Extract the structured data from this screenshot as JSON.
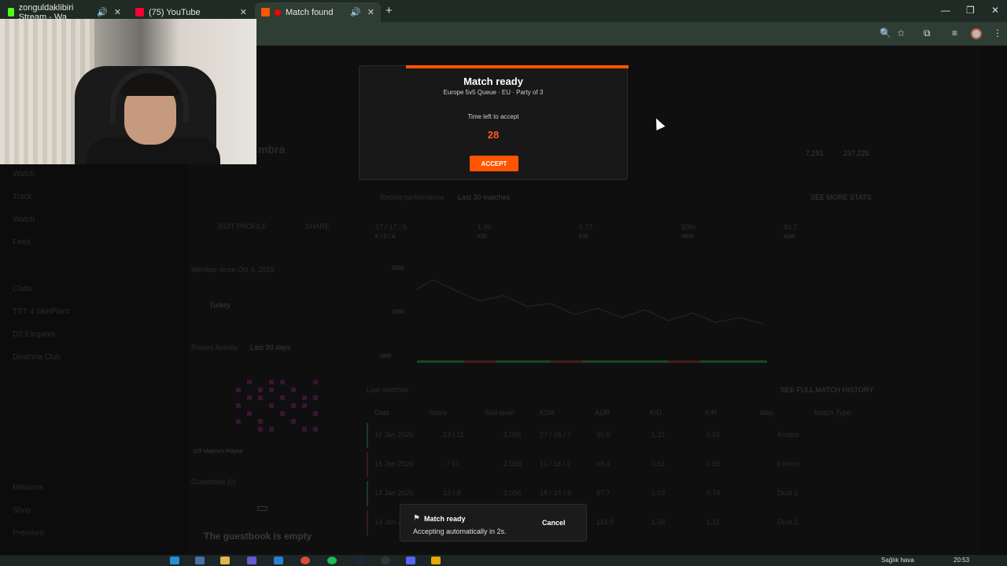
{
  "browser": {
    "tabs": [
      {
        "label": "zonguldaklibiri Stream - Wa",
        "color": "#53fc18"
      },
      {
        "label": "(75) YouTube",
        "color": "#ff0033"
      },
      {
        "label": "Match found",
        "color": "#ff0000"
      }
    ],
    "new_tab": "+",
    "window_controls": [
      "—",
      "❐",
      "✕"
    ]
  },
  "modal": {
    "title": "Match ready",
    "subtitle": "Europe 5v5 Queue · EU · Party of 3",
    "time_label": "Time left to accept",
    "countdown": "28",
    "accept_label": "ACCEPT",
    "accent": "#ff5500"
  },
  "toast": {
    "title": "Match ready",
    "message": "Accepting automatically in 2s.",
    "cancel_label": "Cancel"
  },
  "sidebar": {
    "items": [
      "Watch",
      "Track",
      "Watch",
      "Feed",
      "Clubs",
      "TST 4 SkinPlant",
      "D2 Elegants",
      "Deathria Club",
      "Missions",
      "Shop",
      "Premium"
    ]
  },
  "profile": {
    "name_fragment": "mbra",
    "edit_profile": "EDIT PROFILE",
    "share": "SHARE",
    "member_since": "Member since Oct 4, 2019",
    "country": "Turkey",
    "recent_activity": "Recent Activity",
    "recent_activity_sub": "Last 90 days",
    "matches_played": "103 Matches Played",
    "guestbook": "Guestbook (0)",
    "guestbook_empty": "The guestbook is empty"
  },
  "stats": {
    "recent_performance": "Recent performance",
    "recent_performance_sub": "Last 30 matches",
    "see_more": "SEE MORE STATS",
    "values": [
      {
        "value": "17 / 17 / 5",
        "label": "K / D / A"
      },
      {
        "value": "1.00",
        "label": "K/D"
      },
      {
        "value": "0.77",
        "label": "K/R"
      },
      {
        "value": "50%",
        "label": "HS%"
      },
      {
        "value": "83.7",
        "label": "ADR"
      }
    ],
    "elo_a": "7,291",
    "elo_b": "237,225",
    "chart_ticks": [
      "2000",
      "1900",
      "1800"
    ]
  },
  "matches": {
    "title": "Last matches",
    "see_full": "SEE FULL MATCH HISTORY",
    "headers": [
      "Date",
      "Score",
      "Skill level",
      "KDA",
      "ADR",
      "K/D",
      "K/R",
      "Map",
      "Match Type"
    ],
    "rows": [
      {
        "date": "16 Jan 2026",
        "score": "13 / 11",
        "skill": "2,056",
        "kda": "27 / 16 / 7",
        "adr": "90.5",
        "kd": "1.31",
        "kr": "0.91",
        "map": "Anubis",
        "result": "win"
      },
      {
        "date": "15 Jan 2026",
        "score": "- / 13",
        "skill": "2,028",
        "kda": "11 / 18 / 2",
        "adr": "68.4",
        "kd": "0.61",
        "kr": "0.55",
        "map": "Inferno",
        "result": "loss"
      },
      {
        "date": "14 Jan 2026",
        "score": "13 / 8",
        "skill": "2,056",
        "kda": "18 / 14 / 6",
        "adr": "87.7",
        "kd": "1.03",
        "kr": "0.74",
        "map": "Dust 2",
        "result": "win"
      },
      {
        "date": "14 Jan 2026",
        "score": "- / -",
        "skill": "",
        "kda": "",
        "adr": "114.8",
        "kd": "1.55",
        "kr": "1.11",
        "map": "Dust 2",
        "result": "loss"
      }
    ]
  },
  "taskbar": {
    "time": "20:53",
    "weather": "Sağlık hava"
  }
}
